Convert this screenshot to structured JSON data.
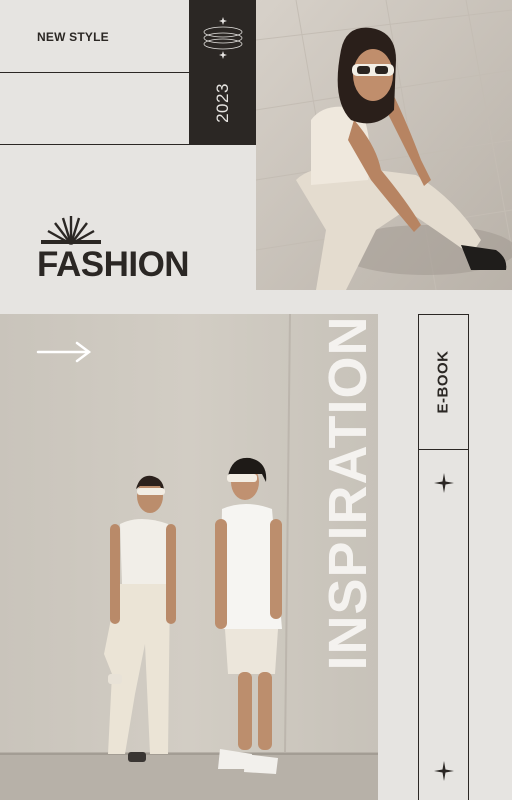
{
  "header": {
    "tag": "NEW STYLE",
    "year": "2023"
  },
  "brand": {
    "title": "FASHION",
    "logo_icon": "sunburst-icon"
  },
  "feature": {
    "headline": "INSPIRATION",
    "arrow_icon": "arrow-right-icon"
  },
  "ebook": {
    "label": "E-BOOK",
    "icons": [
      "sparkle-icon",
      "sparkle-icon"
    ]
  },
  "colors": {
    "background": "#e6e4e1",
    "dark": "#2b2724",
    "light_text": "#f4f2ef"
  }
}
